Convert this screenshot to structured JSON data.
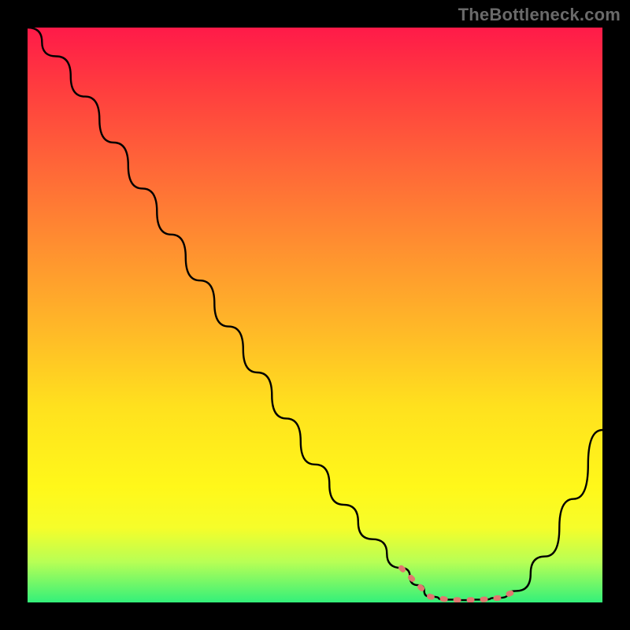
{
  "watermark": "TheBottleneck.com",
  "colors": {
    "background": "#000000",
    "gradient_top": "#ff1a49",
    "gradient_mid": "#ffe11e",
    "gradient_bottom": "#33f07a",
    "curve": "#000000",
    "highlight_dots": "#e0776f"
  },
  "chart_data": {
    "type": "line",
    "title": "",
    "xlabel": "",
    "ylabel": "",
    "xlim": [
      0,
      100
    ],
    "ylim": [
      0,
      100
    ],
    "x": [
      0,
      5,
      10,
      15,
      20,
      25,
      30,
      35,
      40,
      45,
      50,
      55,
      60,
      65,
      68,
      70,
      73,
      76,
      79,
      82,
      85,
      90,
      95,
      100
    ],
    "values": [
      100,
      95,
      88,
      80,
      72,
      64,
      56,
      48,
      40,
      32,
      24,
      17,
      11,
      6,
      3,
      1,
      0.5,
      0.4,
      0.5,
      0.8,
      2,
      8,
      18,
      30
    ],
    "highlight_range_x": [
      65,
      85
    ],
    "annotations": []
  }
}
